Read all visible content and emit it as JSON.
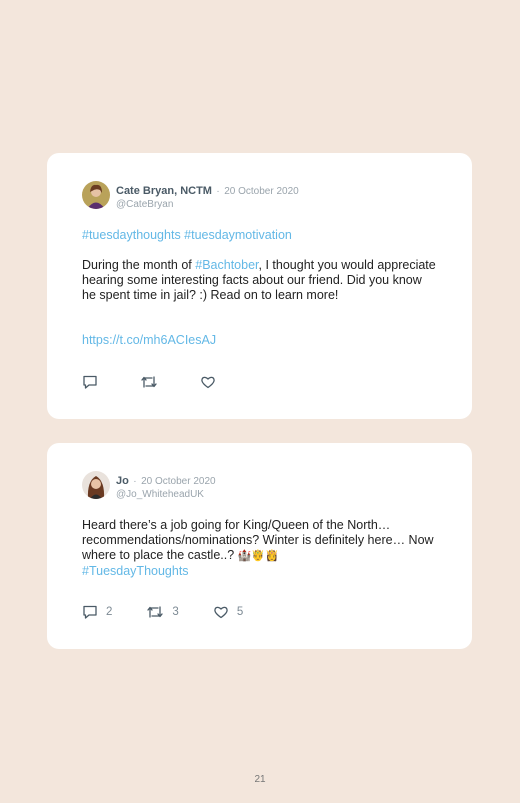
{
  "tweets": [
    {
      "author": "Cate Bryan, NCTM",
      "date": "20 October 2020",
      "handle": "@CateBryan",
      "hashtags": "#tuesdaythoughts #tuesdaymotivation",
      "body_pre": "During the month of ",
      "body_tag": "#Bachtober",
      "body_post": ", I thought you would appreciate hearing some interesting facts about our friend. Did you know he spent time in jail? :) Read on to learn more!",
      "url": "https://t.co/mh6ACIesAJ",
      "replies": "",
      "retweets": "",
      "likes": ""
    },
    {
      "author": "Jo",
      "date": "20 October 2020",
      "handle": "@Jo_WhiteheadUK",
      "body": "Heard there’s a job going for King/Queen of the North… recommendations/nominations? Winter is definitely here… Now where to place the castle..?",
      "emojis": "🏰🤴👸",
      "hashtag": "#TuesdayThoughts",
      "replies": "2",
      "retweets": "3",
      "likes": "5"
    }
  ],
  "separator": "·",
  "page_number": "21",
  "colors": {
    "background": "#f3e6dc",
    "link": "#63b8e6",
    "meta": "#9aa4ac"
  }
}
